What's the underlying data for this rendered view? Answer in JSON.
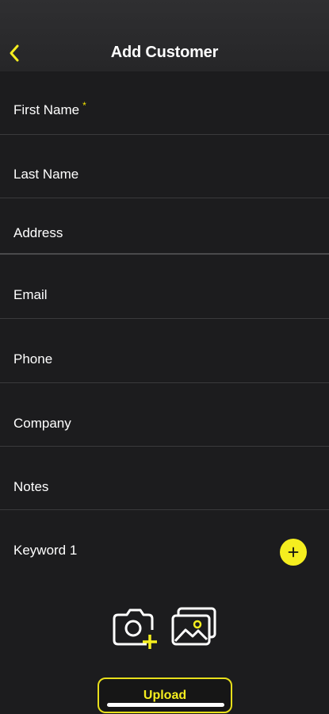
{
  "header": {
    "title": "Add Customer",
    "back_icon": "chevron-left-icon",
    "accent": "#f5ee1f"
  },
  "form": {
    "fields": [
      {
        "label": "First Name",
        "required_mark": "*"
      },
      {
        "label": "Last Name"
      },
      {
        "label": "Address"
      },
      {
        "label": "Email"
      },
      {
        "label": "Phone"
      },
      {
        "label": "Company"
      },
      {
        "label": "Notes"
      },
      {
        "label": "Keyword 1",
        "action_icon": "plus-icon"
      }
    ]
  },
  "media": {
    "camera_icon": "camera-add-icon",
    "gallery_icon": "photo-gallery-icon"
  },
  "upload": {
    "label": "Upload"
  }
}
